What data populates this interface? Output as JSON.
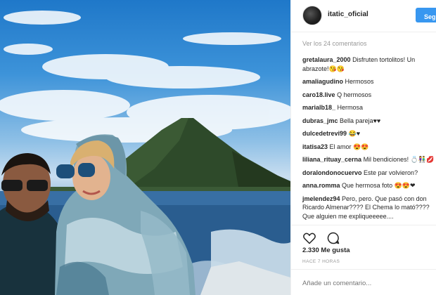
{
  "post": {
    "username": "itatic_oficial",
    "follow_label": "Segu",
    "view_all_comments": "Ver los 24 comentarios",
    "comments": [
      {
        "user": "gretalaura_2000",
        "text": "Disfruten tortolitos! Un abrazote!😘😘"
      },
      {
        "user": "amaliagudino",
        "text": "Hermosos"
      },
      {
        "user": "caro18.live",
        "text": "Q hermosos"
      },
      {
        "user": "marialb18_",
        "text": "Hermosa"
      },
      {
        "user": "dubras_jmc",
        "text": "Bella pareja♥♥"
      },
      {
        "user": "dulcedetrevi99",
        "text": "😂♥"
      },
      {
        "user": "itatisa23",
        "text": "El amor 😍😍"
      },
      {
        "user": "liliana_rituay_cerna",
        "text": "Mil bendiciones! 💍👫💋"
      },
      {
        "user": "doralondonocuervo",
        "text": "Este par volvieron?"
      },
      {
        "user": "anna.romma",
        "text": "Que hermosa foto 😍😍❤"
      },
      {
        "user": "jmelendez94",
        "text": "Pero, pero. Que pasó con don Ricardo Almenar???? El Chema lo mató???? Que alguien me expliqueeeee...."
      }
    ],
    "likes": "2.330 Me gusta",
    "time_ago": "HACE 7 HORAS",
    "add_comment_placeholder": "Añade un comentario..."
  },
  "icons": {
    "like": "heart-icon",
    "comment": "comment-bubble-icon"
  },
  "colors": {
    "follow_button": "#3897f0",
    "muted_text": "#999999",
    "text": "#262626"
  }
}
